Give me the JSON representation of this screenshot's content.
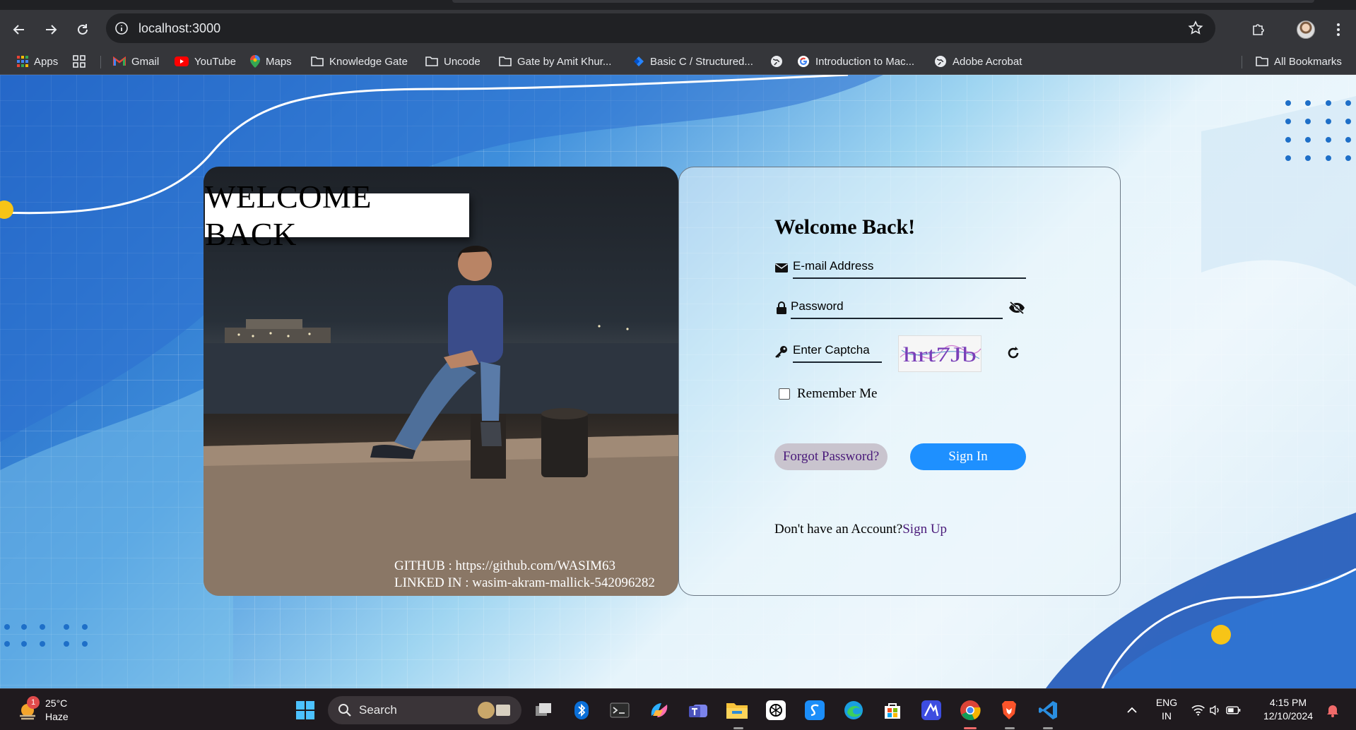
{
  "browser": {
    "url": "localhost:3000",
    "bookmarks": [
      {
        "label": "Apps",
        "icon": "apps-grid-icon"
      },
      {
        "label": "Gmail",
        "icon": "gmail-icon"
      },
      {
        "label": "YouTube",
        "icon": "youtube-icon"
      },
      {
        "label": "Maps",
        "icon": "maps-icon"
      },
      {
        "label": "Knowledge Gate",
        "icon": "folder-icon"
      },
      {
        "label": "Uncode",
        "icon": "folder-icon"
      },
      {
        "label": "Gate by Amit Khur...",
        "icon": "folder-icon"
      },
      {
        "label": "Basic C / Structured...",
        "icon": "jira-icon"
      },
      {
        "label": "Introduction to Mac...",
        "icon": "google-icon"
      },
      {
        "label": "Adobe Acrobat",
        "icon": "globe-icon"
      }
    ],
    "all_bookmarks_label": "All Bookmarks"
  },
  "card": {
    "welcome_banner": "WELCOME BACK",
    "github_line": "GITHUB : https://github.com/WASIM63",
    "linkedin_line": "LINKED IN : wasim-akram-mallick-542096282"
  },
  "form": {
    "title": "Welcome Back!",
    "email_placeholder": "E-mail Address",
    "password_placeholder": "Password",
    "captcha_placeholder": "Enter Captcha",
    "captcha_text": "hrt7Jb",
    "remember_label": "Remember Me",
    "forgot_label": "Forgot Password?",
    "signin_label": "Sign In",
    "no_account_text": "Don't have an Account?",
    "signup_label": "Sign Up"
  },
  "taskbar": {
    "weather_badge": "1",
    "temperature": "25°C",
    "condition": "Haze",
    "search_label": "Search",
    "language_line1": "ENG",
    "language_line2": "IN",
    "time": "4:15 PM",
    "date": "12/10/2024"
  },
  "colors": {
    "signin_button": "#1e90ff",
    "forgot_button": "#c9c4ce",
    "link_purple": "#4a1a7a",
    "chrome_dark": "#35363a"
  }
}
